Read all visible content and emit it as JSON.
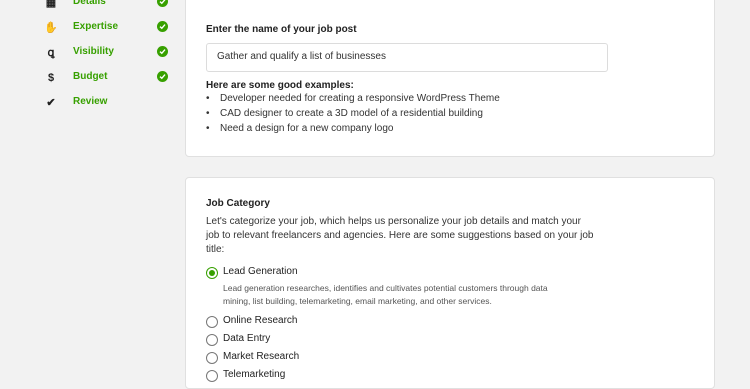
{
  "sidebar": {
    "steps": [
      {
        "label": "Details",
        "icon": "document-icon",
        "glyph": "▦",
        "done": true
      },
      {
        "label": "Expertise",
        "icon": "hand-icon",
        "glyph": "✋",
        "done": true
      },
      {
        "label": "Visibility",
        "icon": "search-person-icon",
        "glyph": "ꝗ",
        "done": true
      },
      {
        "label": "Budget",
        "icon": "dollar-icon",
        "glyph": "$",
        "done": true
      },
      {
        "label": "Review",
        "icon": "checkmark-icon",
        "glyph": "✔",
        "done": false
      }
    ]
  },
  "job_post": {
    "name_label": "Enter the name of your job post",
    "name_value": "Gather and qualify a list of businesses",
    "examples_title": "Here are some good examples:",
    "examples": [
      "Developer needed for creating a responsive WordPress Theme",
      "CAD designer to create a 3D model of a residential building",
      "Need a design for a new company logo"
    ]
  },
  "category": {
    "title": "Job Category",
    "intro_line1": "Let's categorize your job, which helps us personalize your job details and match your",
    "intro_line2": "job to relevant freelancers and agencies. Here are some suggestions based on your job",
    "intro_line3": "title:",
    "options": [
      {
        "label": "Lead Generation",
        "selected": true,
        "desc_line1": "Lead generation researches, identifies and cultivates potential customers through data",
        "desc_line2": "mining, list building, telemarketing, email marketing, and other services."
      },
      {
        "label": "Online Research",
        "selected": false
      },
      {
        "label": "Data Entry",
        "selected": false
      },
      {
        "label": "Market Research",
        "selected": false
      },
      {
        "label": "Telemarketing",
        "selected": false
      }
    ]
  },
  "colors": {
    "accent": "#37a000",
    "background": "#f2f2f2",
    "card": "#ffffff"
  }
}
